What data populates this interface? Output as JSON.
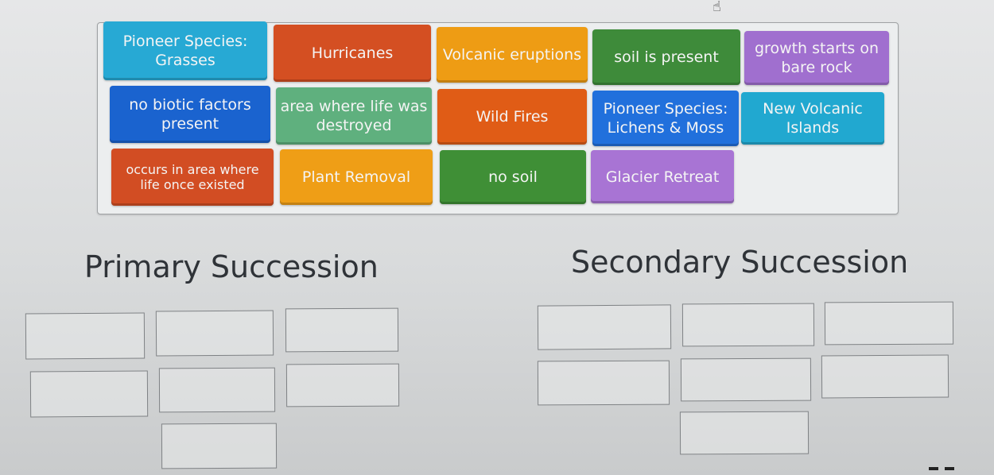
{
  "activity": {
    "type": "drag-and-drop sorting",
    "word_bank": [
      {
        "id": "t1",
        "label": "Pioneer Species: Grasses",
        "color": "#27a9d4"
      },
      {
        "id": "t2",
        "label": "Hurricanes",
        "color": "#d44f22"
      },
      {
        "id": "t3",
        "label": "Volcanic eruptions",
        "color": "#ee9c14"
      },
      {
        "id": "t4",
        "label": "soil is present",
        "color": "#3e8b3a"
      },
      {
        "id": "t5",
        "label": "growth starts on bare rock",
        "color": "#a06fcf"
      },
      {
        "id": "t6",
        "label": "no biotic factors present",
        "color": "#1a63cf"
      },
      {
        "id": "t7",
        "label": "area where life was destroyed",
        "color": "#5fb07e"
      },
      {
        "id": "t8",
        "label": "Wild Fires",
        "color": "#e05c16"
      },
      {
        "id": "t9",
        "label": "Pioneer Species: Lichens & Moss",
        "color": "#2170dc"
      },
      {
        "id": "t10",
        "label": "New Volcanic Islands",
        "color": "#21a8d0"
      },
      {
        "id": "t11",
        "label": "occurs in area where life once existed",
        "color": "#d24d23"
      },
      {
        "id": "t12",
        "label": "Plant Removal",
        "color": "#ef9e16"
      },
      {
        "id": "t13",
        "label": "no soil",
        "color": "#3f8f36"
      },
      {
        "id": "t14",
        "label": "Glacier Retreat",
        "color": "#a874d4"
      }
    ],
    "categories": [
      {
        "title": "Primary Succession",
        "slots": [
          "",
          "",
          "",
          "",
          "",
          "",
          ""
        ]
      },
      {
        "title": "Secondary Succession",
        "slots": [
          "",
          "",
          "",
          "",
          "",
          "",
          ""
        ]
      }
    ]
  },
  "icons": {
    "cursor": "hand-pointer-icon"
  }
}
